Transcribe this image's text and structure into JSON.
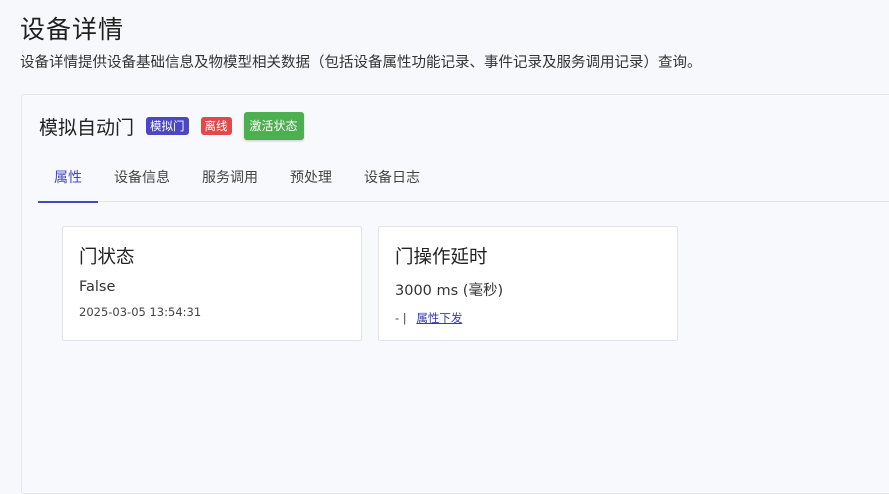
{
  "page": {
    "title": "设备详情",
    "description": "设备详情提供设备基础信息及物模型相关数据（包括设备属性功能记录、事件记录及服务调用记录）查询。"
  },
  "device": {
    "name": "模拟自动门",
    "model_badge": "模拟门",
    "status_badge": "离线",
    "activate_label": "激活状态"
  },
  "tabs": [
    {
      "label": "属性",
      "active": true
    },
    {
      "label": "设备信息",
      "active": false
    },
    {
      "label": "服务调用",
      "active": false
    },
    {
      "label": "预处理",
      "active": false
    },
    {
      "label": "设备日志",
      "active": false
    }
  ],
  "properties": [
    {
      "title": "门状态",
      "value": "False",
      "timestamp": "2025-03-05 13:54:31"
    },
    {
      "title": "门操作延时",
      "value": "3000 ms (毫秒)",
      "prefix": "- |",
      "action_label": "属性下发"
    }
  ],
  "colors": {
    "accent": "#4a46c4",
    "offline": "#e34848",
    "activate": "#4caf50"
  }
}
